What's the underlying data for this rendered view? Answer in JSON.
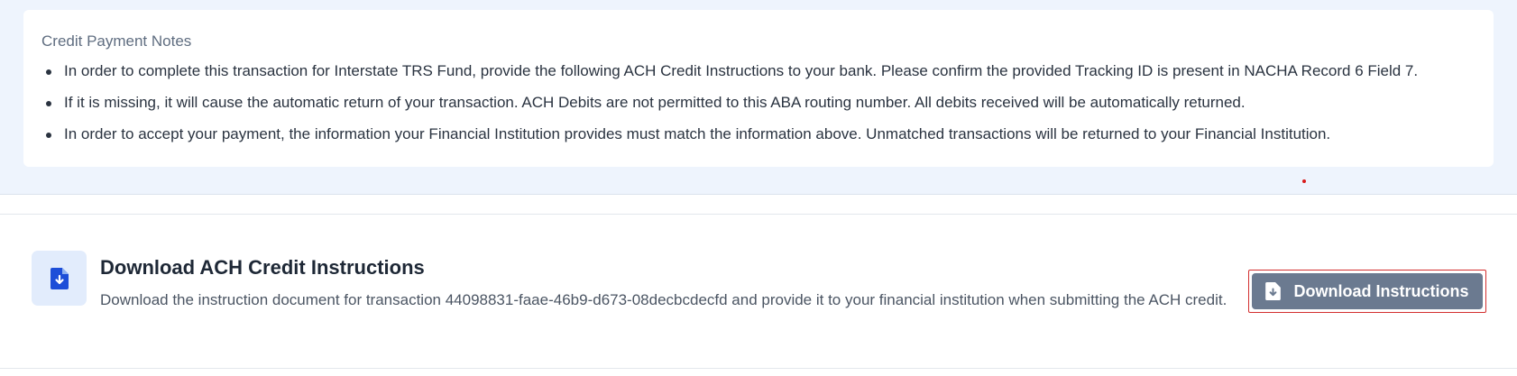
{
  "notes": {
    "title": "Credit Payment Notes",
    "items": [
      "In order to complete this transaction for Interstate TRS Fund, provide the following ACH Credit Instructions to your bank. Please confirm the provided Tracking ID is present in NACHA Record 6 Field 7.",
      "If it is missing, it will cause the automatic return of your transaction. ACH Debits are not permitted to this ABA routing number. All debits received will be automatically returned.",
      "In order to accept your payment, the information your Financial Institution provides must match the information above. Unmatched transactions will be returned to your Financial Institution."
    ]
  },
  "download": {
    "title": "Download ACH Credit Instructions",
    "description": "Download the instruction document for transaction 44098831-faae-46b9-d673-08decbcdecfd and provide it to your financial institution when submitting the ACH credit.",
    "button_label": "Download Instructions",
    "icon": "file-download-icon",
    "button_icon": "file-download-icon"
  },
  "colors": {
    "accent": "#1d4ed8",
    "button_bg": "#6b7a90",
    "panel_bg": "#eef4fd",
    "highlight_outline": "#d32f2f"
  }
}
